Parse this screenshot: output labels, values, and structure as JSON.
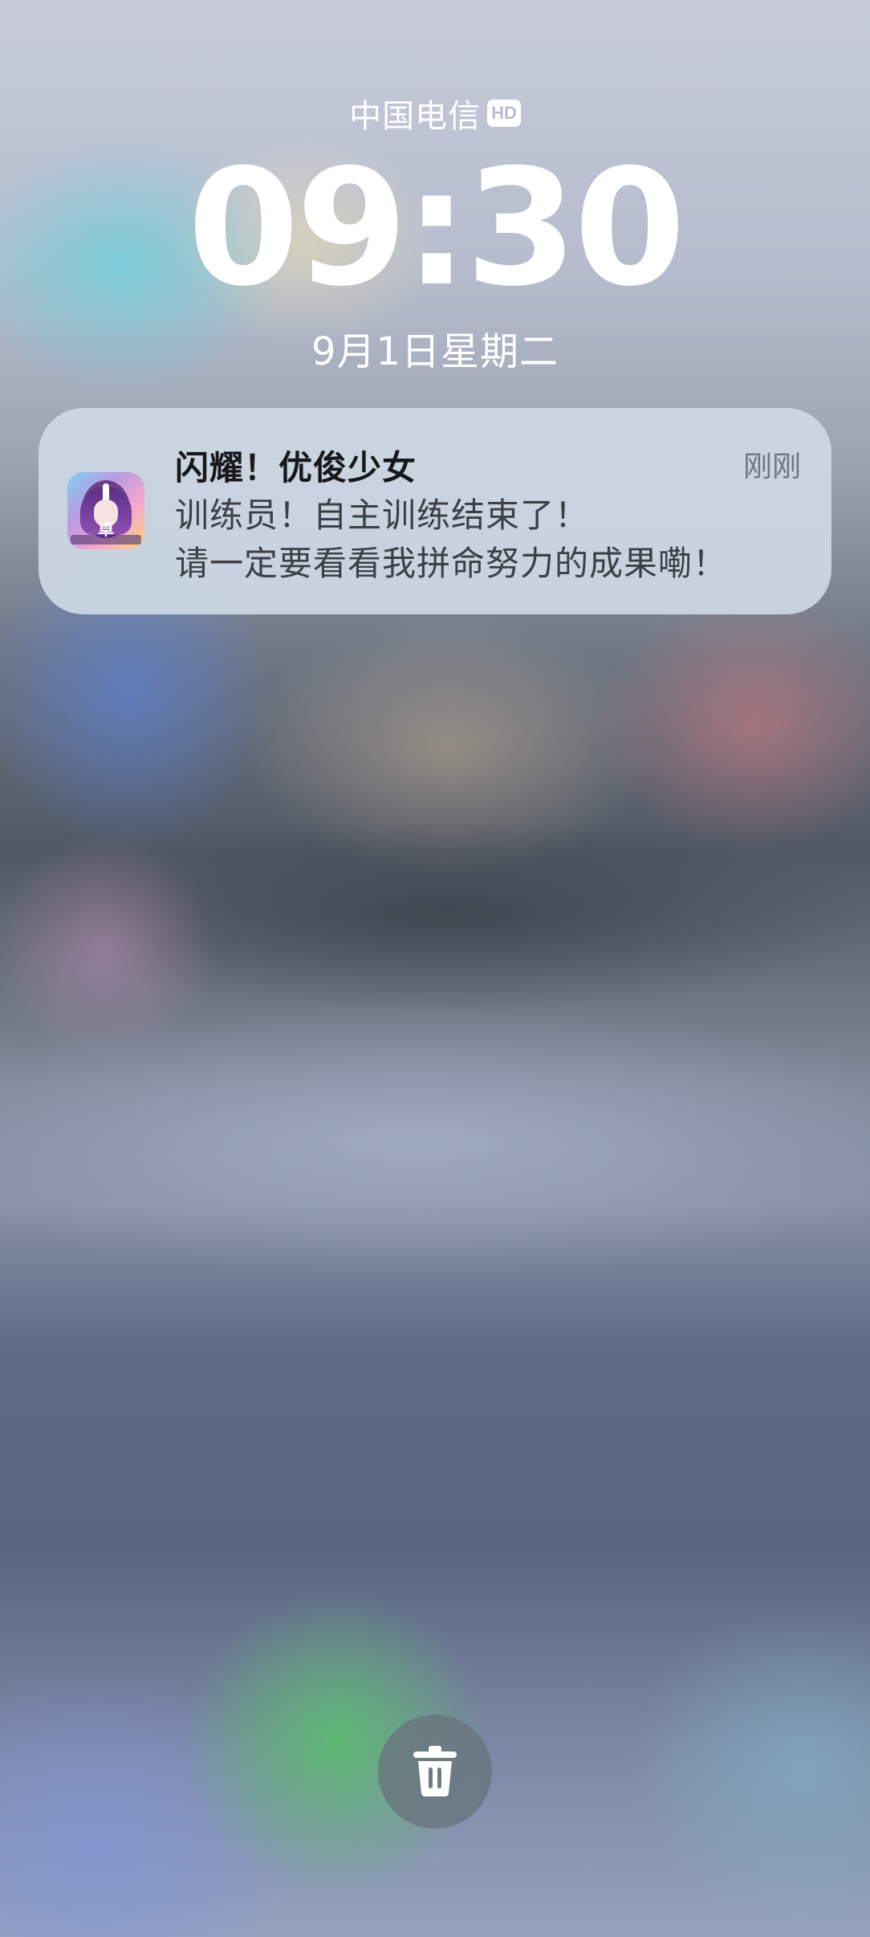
{
  "status": {
    "carrier": "中国电信",
    "network_badge": "HD"
  },
  "lock_screen": {
    "time": "09:30",
    "date": "9月1日星期二"
  },
  "notification": {
    "app_icon": "app-icon-uma-musume",
    "app_icon_glyph": "卓",
    "title": "闪耀！优俊少女",
    "time": "刚刚",
    "body_lines": [
      "训练员！自主训练结束了！",
      "请一定要看看我拼命努力的成果嘞！"
    ]
  },
  "actions": {
    "clear_icon": "trash-icon"
  },
  "colors": {
    "card_background": "#ced8e4",
    "title_text": "#16181c",
    "body_text": "#3b4048",
    "time_text": "#6d7683",
    "clock_text": "#ffffff",
    "trash_button": "#69737d"
  }
}
